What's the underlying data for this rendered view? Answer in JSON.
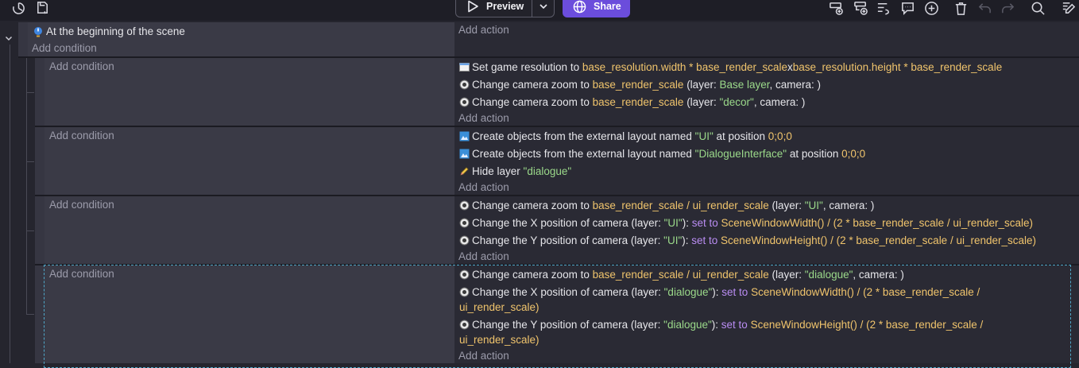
{
  "toolbar": {
    "preview_label": "Preview",
    "share_label": "Share"
  },
  "event1": {
    "condition_text": "At the beginning of the scene",
    "add_condition": "Add condition",
    "add_action": "Add action"
  },
  "sub1": {
    "add_condition": "Add condition",
    "add_action": "Add action",
    "a1": {
      "t1": "Set game resolution to ",
      "e1": "base_resolution.width * base_render_scale",
      "t2": "x",
      "e2": "base_resolution.height * base_render_scale"
    },
    "a2": {
      "t1": "Change camera zoom to ",
      "e1": "base_render_scale",
      "t2": " (layer: ",
      "e2": "Base layer",
      "t3": ", camera: )"
    },
    "a3": {
      "t1": "Change camera zoom to ",
      "e1": "base_render_scale",
      "t2": " (layer: ",
      "e2": "\"decor\"",
      "t3": ", camera: )"
    }
  },
  "sub2": {
    "add_condition": "Add condition",
    "add_action": "Add action",
    "a1": {
      "t1": "Create objects from the external layout named ",
      "e1": "\"UI\"",
      "t2": " at position ",
      "e2": "0;0;0"
    },
    "a2": {
      "t1": "Create objects from the external layout named ",
      "e1": "\"DialogueInterface\"",
      "t2": " at position ",
      "e2": "0;0;0"
    },
    "a3": {
      "t1": "Hide layer ",
      "e1": "\"dialogue\""
    }
  },
  "sub3": {
    "add_condition": "Add condition",
    "add_action": "Add action",
    "a1": {
      "t1": "Change camera zoom to ",
      "e1": "base_render_scale / ui_render_scale",
      "t2": " (layer: ",
      "e2": "\"UI\"",
      "t3": ", camera: )"
    },
    "a2": {
      "t1": "Change the X position of camera  (layer: ",
      "e1": "\"UI\"",
      "t2": "): ",
      "p1": "set to",
      "t3": " ",
      "e2": "SceneWindowWidth() / (2 * base_render_scale / ui_render_scale)"
    },
    "a3": {
      "t1": "Change the Y position of camera  (layer: ",
      "e1": "\"UI\"",
      "t2": "): ",
      "p1": "set to",
      "t3": " ",
      "e2": "SceneWindowHeight() / (2 * base_render_scale / ui_render_scale)"
    }
  },
  "sub4": {
    "add_condition": "Add condition",
    "add_action": "Add action",
    "a1": {
      "t1": "Change camera zoom to ",
      "e1": "base_render_scale / ui_render_scale",
      "t2": " (layer: ",
      "e2": "\"dialogue\"",
      "t3": ", camera: )"
    },
    "a2": {
      "t1": "Change the X position of camera  (layer: ",
      "e1": "\"dialogue\"",
      "t2": "): ",
      "p1": "set to",
      "t3": " ",
      "e2": "SceneWindowWidth() / (2 * base_render_scale / ui_render_scale)"
    },
    "a3": {
      "t1": "Change the Y position of camera  (layer: ",
      "e1": "\"dialogue\"",
      "t2": "): ",
      "p1": "set to",
      "t3": " ",
      "e2": "SceneWindowHeight() / (2 * base_render_scale / ui_render_scale)"
    }
  },
  "icons": [
    "history-icon",
    "save-icon",
    "play-icon",
    "chevron-down-icon",
    "globe-icon",
    "add-event-icon",
    "add-subevent-icon",
    "add-group-icon",
    "add-comment-icon",
    "add-icon",
    "delete-icon",
    "undo-icon",
    "redo-icon",
    "search-icon",
    "edit-icon"
  ],
  "colors": {
    "accent": "#6b4ddc",
    "expression": "#f0c46c",
    "string": "#9bd98a",
    "keyword": "#b98cf2",
    "selection": "#4fa7c8"
  }
}
